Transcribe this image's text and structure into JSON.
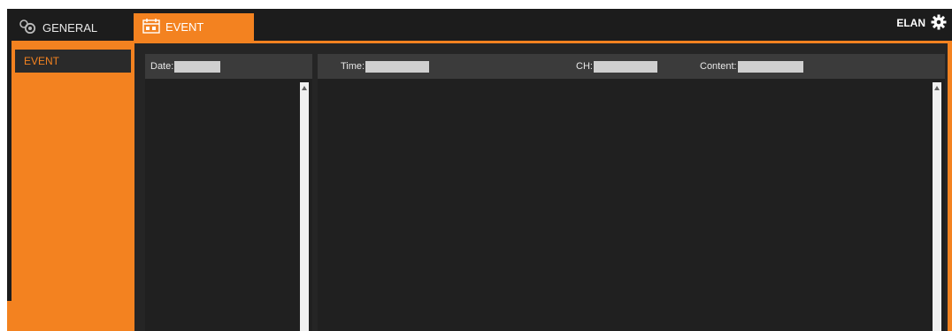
{
  "topbar": {
    "tabs": [
      {
        "label": "GENERAL",
        "icon": "camera-pair-icon",
        "active": false
      },
      {
        "label": "EVENT",
        "icon": "calendar-icon",
        "active": true
      }
    ],
    "brand": "ELAN",
    "settings_icon": "gear-icon"
  },
  "sidebar": {
    "items": [
      {
        "label": "EVENT",
        "selected": true
      }
    ]
  },
  "date_panel": {
    "date_label": "Date:",
    "date_value": ""
  },
  "list_panel": {
    "time_label": "Time:",
    "time_value": "",
    "ch_label": "CH:",
    "ch_value": "",
    "content_label": "Content:",
    "content_value": ""
  },
  "colors": {
    "accent": "#f38220",
    "dark": "#1c1c1c",
    "panel_header": "#3b3b3b"
  }
}
